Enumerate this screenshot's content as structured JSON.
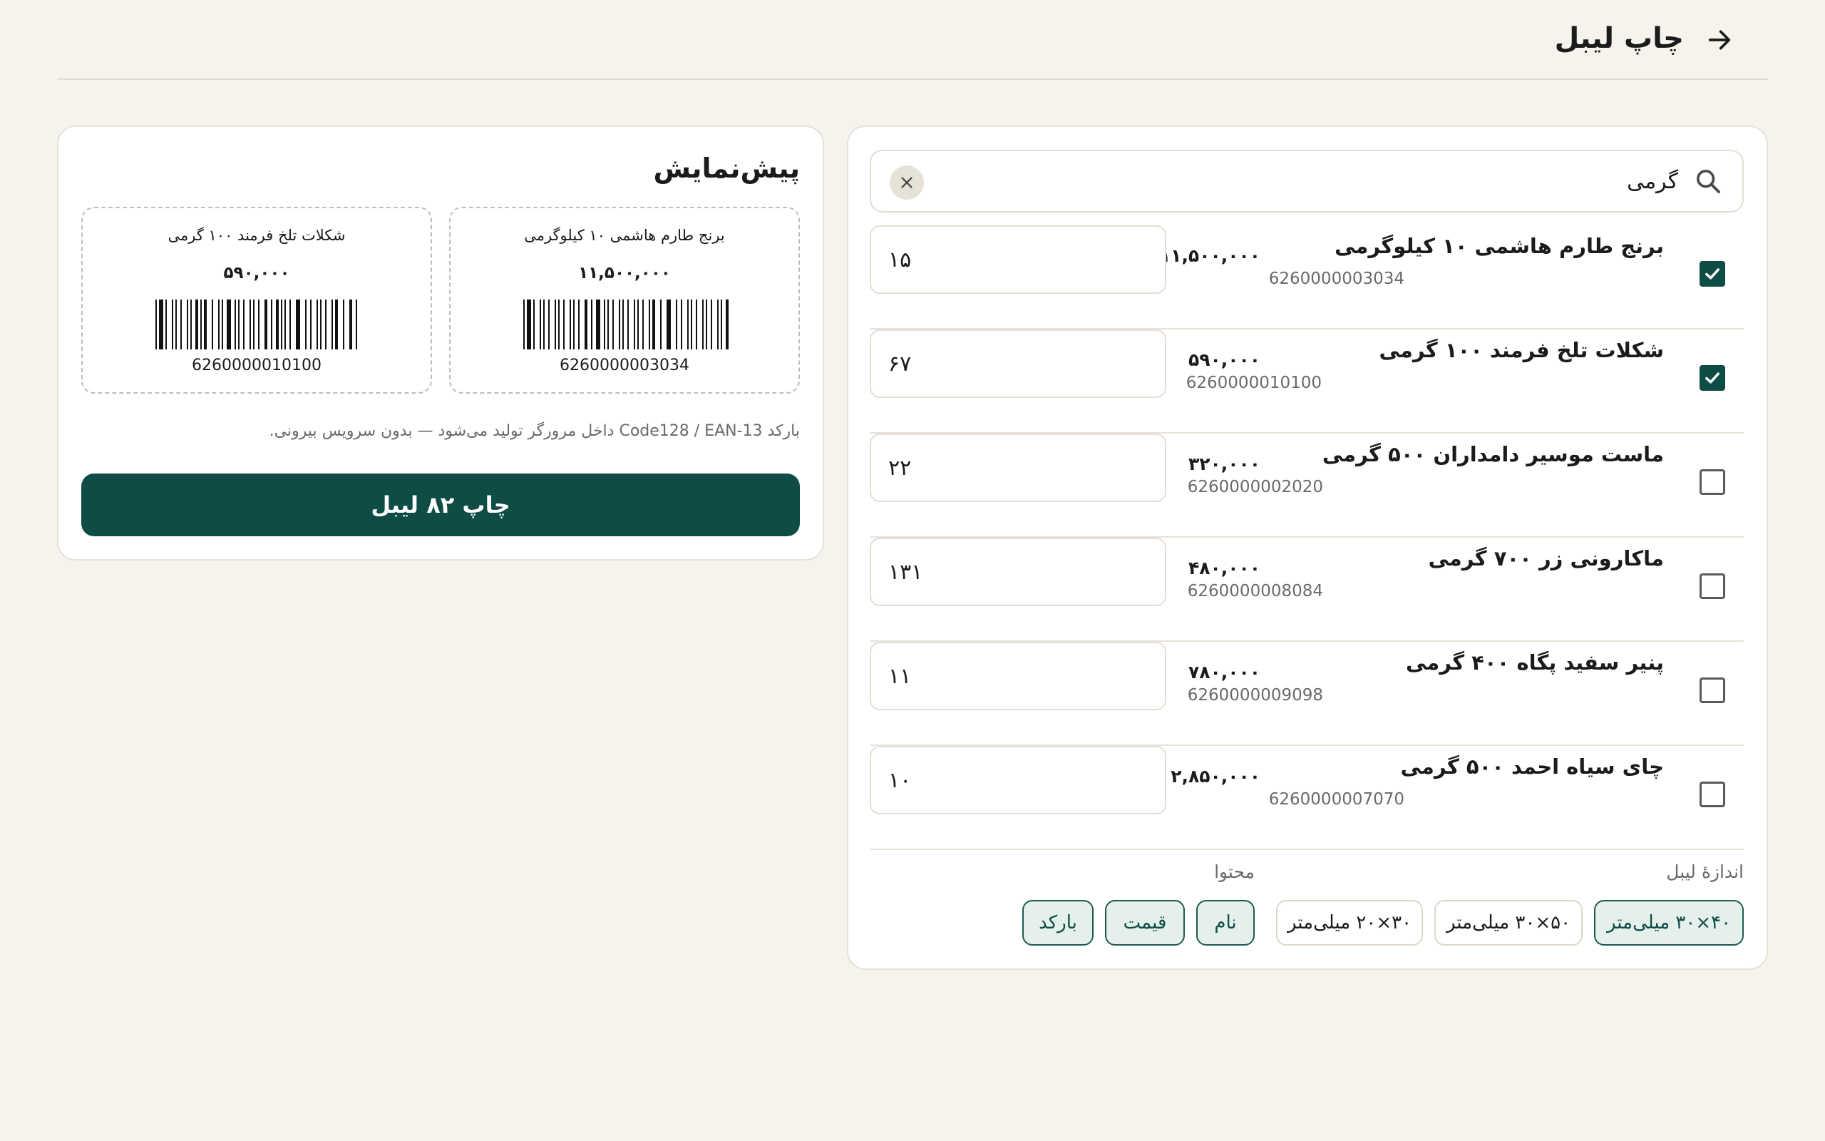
{
  "header": {
    "title": "چاپ لیبل",
    "back_icon": "arrow-right-icon"
  },
  "search": {
    "value": "گرمی",
    "placeholder": ""
  },
  "products": [
    {
      "name": "برنج طارم هاشمی ۱۰ کیلوگرمی",
      "barcode": "6260000003034",
      "price": "۱۱,۵۰۰,۰۰۰",
      "quantity": "۱۵",
      "checked": true
    },
    {
      "name": "شکلات تلخ فرمند ۱۰۰ گرمی",
      "barcode": "6260000010100",
      "price": "۵۹۰,۰۰۰",
      "quantity": "۶۷",
      "checked": true
    },
    {
      "name": "ماست موسیر دامداران ۵۰۰ گرمی",
      "barcode": "6260000002020",
      "price": "۳۲۰,۰۰۰",
      "quantity": "۲۲",
      "checked": false
    },
    {
      "name": "ماکارونی زر ۷۰۰ گرمی",
      "barcode": "6260000008084",
      "price": "۴۸۰,۰۰۰",
      "quantity": "۱۳۱",
      "checked": false
    },
    {
      "name": "پنیر سفید پگاه ۴۰۰ گرمی",
      "barcode": "6260000009098",
      "price": "۷۸۰,۰۰۰",
      "quantity": "۱۱",
      "checked": false
    },
    {
      "name": "چای سیاه احمد ۵۰۰ گرمی",
      "barcode": "6260000007070",
      "price": "۲,۸۵۰,۰۰۰",
      "quantity": "۱۰",
      "checked": false
    }
  ],
  "options": {
    "size_label": "اندازهٔ لیبل",
    "sizes": [
      {
        "label": "۴۰×۳۰ میلی‌متر",
        "active": true
      },
      {
        "label": "۵۰×۳۰ میلی‌متر",
        "active": false
      },
      {
        "label": "۳۰×۲۰ میلی‌متر",
        "active": false
      }
    ],
    "content_label": "محتوا",
    "contents": [
      {
        "label": "نام",
        "active": true
      },
      {
        "label": "قیمت",
        "active": true
      },
      {
        "label": "بارکد",
        "active": true
      }
    ]
  },
  "preview": {
    "title": "پیش‌نمایش",
    "labels": [
      {
        "name": "برنج طارم هاشمی ۱۰ کیلوگرمی",
        "price": "۱۱,۵۰۰,۰۰۰",
        "barcode": "6260000003034"
      },
      {
        "name": "شکلات تلخ فرمند ۱۰۰ گرمی",
        "price": "۵۹۰,۰۰۰",
        "barcode": "6260000010100"
      }
    ],
    "note": "بارکد Code128 / EAN-13 داخل مرورگر تولید می‌شود — بدون سرویس بیرونی.",
    "print_button": "چاپ ۸۲ لیبل"
  },
  "colors": {
    "accent": "#0f4c45",
    "background": "#f6f3ed",
    "card": "#ffffff"
  }
}
